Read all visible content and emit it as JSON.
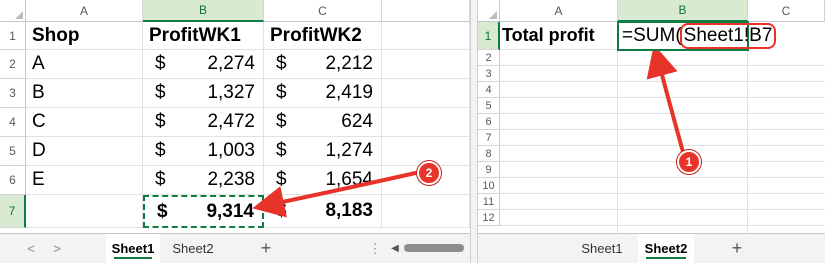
{
  "left_pane": {
    "columns": [
      "A",
      "B",
      "C"
    ],
    "rows": [
      "1",
      "2",
      "3",
      "4",
      "5",
      "6",
      "7"
    ],
    "headers": [
      "Shop",
      "ProfitWK1",
      "ProfitWK2"
    ],
    "currency_symbol": "$",
    "data": [
      {
        "shop": "A",
        "wk1": "2,274",
        "wk2": "2,212"
      },
      {
        "shop": "B",
        "wk1": "1,327",
        "wk2": "2,419"
      },
      {
        "shop": "C",
        "wk1": "2,472",
        "wk2": "624"
      },
      {
        "shop": "D",
        "wk1": "1,003",
        "wk2": "1,274"
      },
      {
        "shop": "E",
        "wk1": "2,238",
        "wk2": "1,654"
      }
    ],
    "totals": {
      "wk1": "9,314",
      "wk2": "8,183"
    },
    "tabs": [
      "Sheet1",
      "Sheet2"
    ],
    "active_tab": "Sheet1",
    "add_sheet": "+",
    "nav_prev": "<",
    "nav_next": ">",
    "more_icon": "⋮",
    "scroll_left": "◀"
  },
  "right_pane": {
    "columns": [
      "A",
      "B",
      "C"
    ],
    "rows": [
      "1",
      "2",
      "3",
      "4",
      "5",
      "6",
      "7",
      "8",
      "9",
      "10",
      "11",
      "12"
    ],
    "label": "Total profit",
    "formula_prefix": "=SUM(",
    "formula_ref": "Sheet1!B7",
    "tabs": [
      "Sheet1",
      "Sheet2"
    ],
    "active_tab": "Sheet2",
    "add_sheet": "+"
  },
  "annotations": {
    "callout_1": "1",
    "callout_2": "2",
    "color": "#e8332a"
  },
  "colors": {
    "excel_green": "#107c41",
    "header_highlight": "#d9ead3"
  }
}
